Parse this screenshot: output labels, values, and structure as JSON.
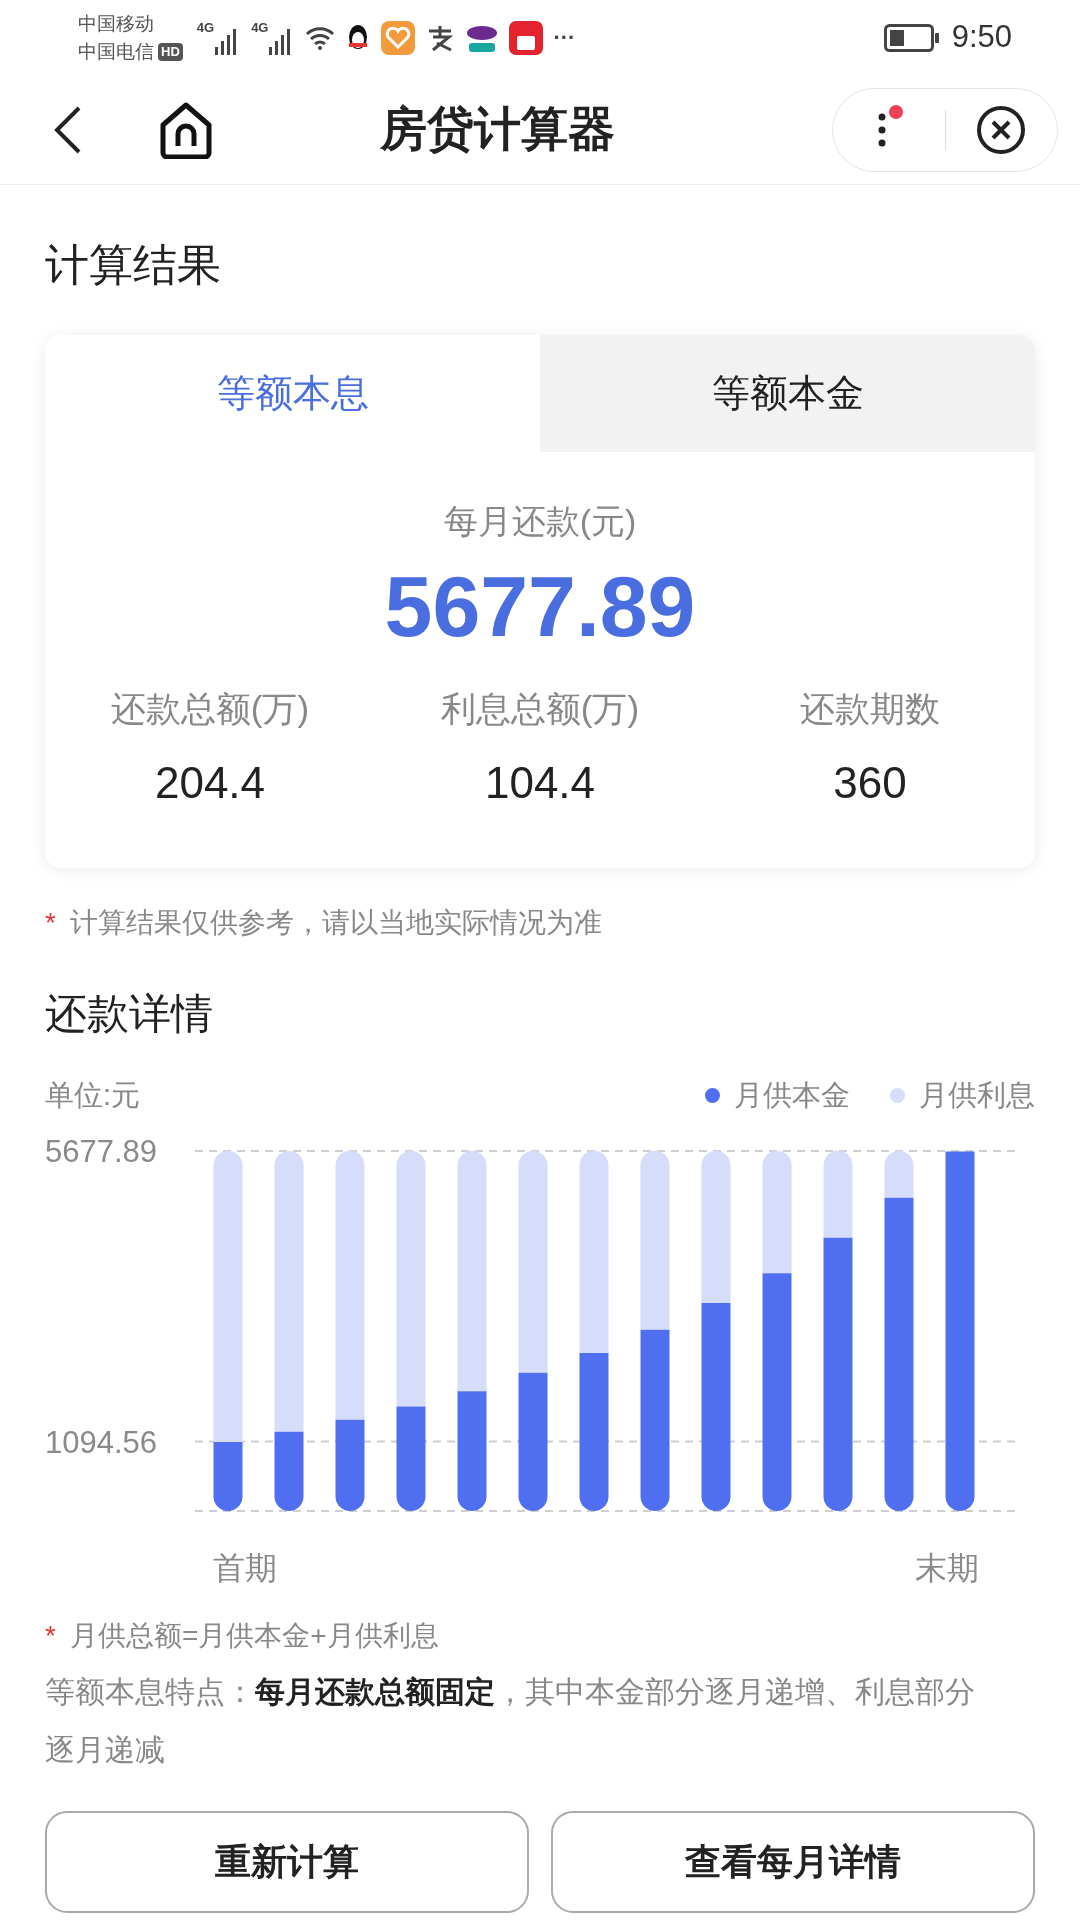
{
  "status_bar": {
    "carriers": [
      "中国移动",
      "中国电信"
    ],
    "hd_badge": "HD",
    "network_labels": [
      "4G",
      "4G"
    ],
    "more": "···",
    "time": "9:50"
  },
  "nav_bar": {
    "title": "房贷计算器"
  },
  "section_title": "计算结果",
  "result_card": {
    "tabs": [
      {
        "label": "等额本息",
        "selected": true
      },
      {
        "label": "等额本金",
        "selected": false
      }
    ],
    "monthly_label": "每月还款(元)",
    "monthly_amount": "5677.89",
    "stats": [
      {
        "label": "还款总额(万)",
        "value": "204.4"
      },
      {
        "label": "利息总额(万)",
        "value": "104.4"
      },
      {
        "label": "还款期数",
        "value": "360"
      }
    ]
  },
  "disclaimer": {
    "mark": "*",
    "text": "计算结果仅供参考，请以当地实际情况为准"
  },
  "details": {
    "title": "还款详情",
    "unit": "单位:元",
    "chart_data": {
      "type": "bar",
      "stacked": true,
      "categories": [
        "首期",
        null,
        null,
        null,
        null,
        null,
        null,
        null,
        null,
        null,
        null,
        null,
        "末期"
      ],
      "ylim": [
        0,
        5677.89
      ],
      "yticks": [
        {
          "value": 1094.56,
          "label": "1094.56"
        },
        {
          "value": 5677.89,
          "label": "5677.89"
        }
      ],
      "series": [
        {
          "name": "月供本金",
          "color": "#4f6ff0",
          "values": [
            1090,
            1250,
            1440,
            1650,
            1890,
            2180,
            2490,
            2860,
            3280,
            3750,
            4310,
            4940,
            5670
          ]
        },
        {
          "name": "月供利息",
          "color": "#d5ddfa",
          "values": [
            4590,
            4430,
            4240,
            4030,
            3790,
            3500,
            3190,
            2820,
            2400,
            1930,
            1370,
            740,
            null
          ]
        }
      ]
    },
    "notes": [
      {
        "mark": "*",
        "text": "月供总额=月供本金+月供利息"
      }
    ],
    "description": "等额本息特点：**每月还款总额固定**，其中本金部分逐月递增、利息部分逐月递减"
  },
  "buttons": [
    "重新计算",
    "查看每月详情"
  ]
}
